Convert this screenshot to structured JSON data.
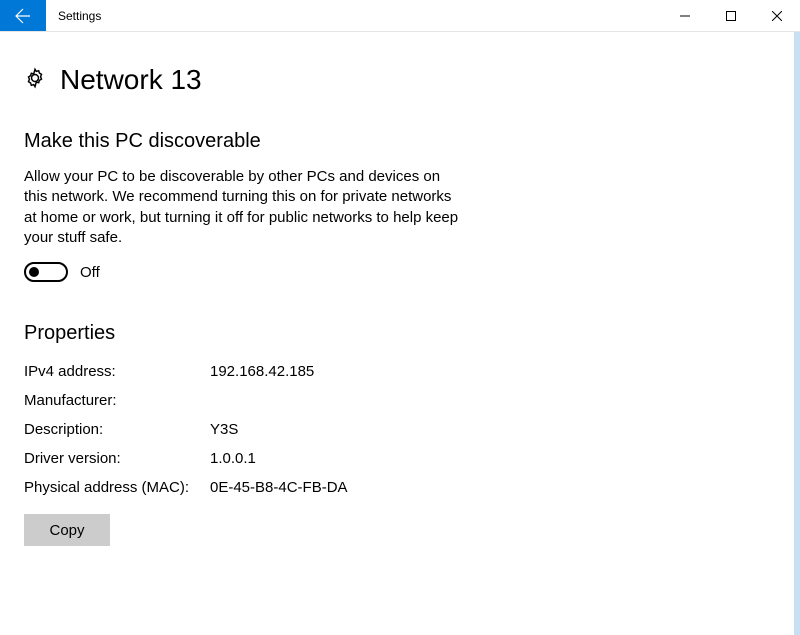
{
  "window": {
    "title": "Settings"
  },
  "page": {
    "title": "Network  13"
  },
  "discoverable": {
    "heading": "Make this PC discoverable",
    "description": "Allow your PC to be discoverable by other PCs and devices on this network. We recommend turning this on for private networks at home or work, but turning it off for public networks to help keep your stuff safe.",
    "toggle_state": "Off"
  },
  "properties": {
    "heading": "Properties",
    "rows": [
      {
        "label": "IPv4 address:",
        "value": "192.168.42.185"
      },
      {
        "label": "Manufacturer:",
        "value": ""
      },
      {
        "label": "Description:",
        "value": "Y3S"
      },
      {
        "label": "Driver version:",
        "value": "1.0.0.1"
      },
      {
        "label": "Physical address (MAC):",
        "value": "0E-45-B8-4C-FB-DA"
      }
    ],
    "copy_label": "Copy"
  }
}
